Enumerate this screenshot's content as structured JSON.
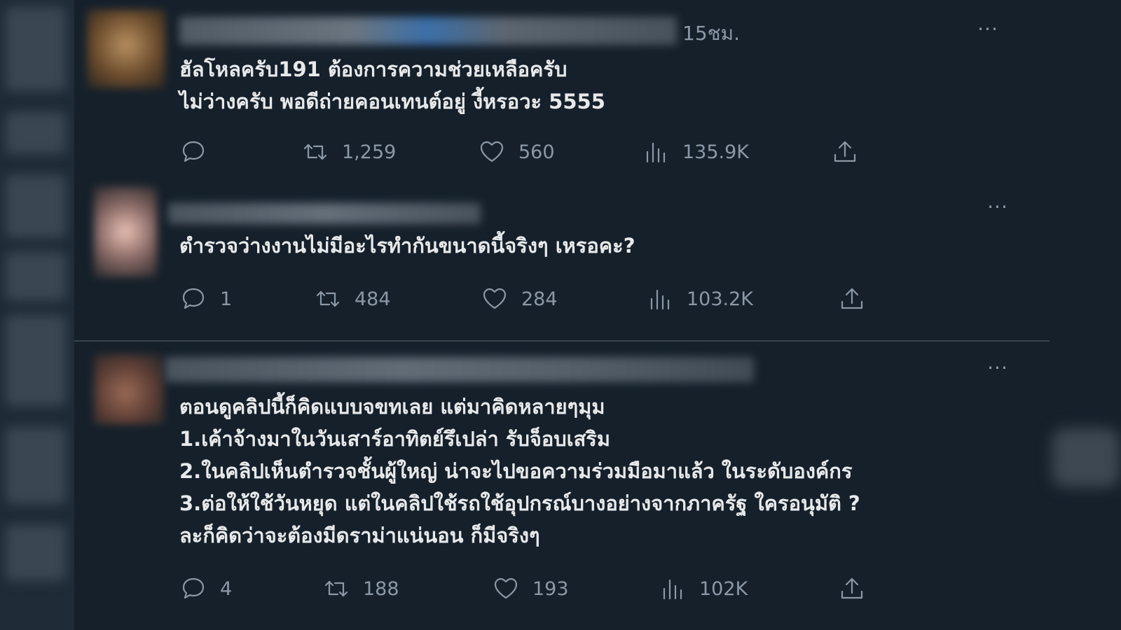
{
  "tweets": [
    {
      "timestamp": "15ชม.",
      "more": "···",
      "lines": [
        "ฮัลโหลครับ191 ต้องการความช่วยเหลือครับ",
        "ไม่ว่างครับ พอดีถ่ายคอนเทนต์อยู่ งี้หรอวะ 5555"
      ],
      "replies": "",
      "retweets": "1,259",
      "likes": "560",
      "views": "135.9K"
    },
    {
      "more": "···",
      "lines": [
        "ตำรวจว่างงานไม่มีอะไรทำกันขนาดนี้จริงๆ เหรอคะ?"
      ],
      "replies": "1",
      "retweets": "484",
      "likes": "284",
      "views": "103.2K"
    },
    {
      "more": "···",
      "lines": [
        "ตอนดูคลิปนี้ก็คิดแบบจขทเลย แต่มาคิดหลายๆมุม",
        "1.เค้าจ้างมาในวันเสาร์อาทิตย์รึเปล่า รับจ็อบเสริม",
        "2.ในคลิปเห็นตำรวจชั้นผู้ใหญ่ น่าจะไปขอความร่วมมือมาแล้ว ในระดับองค์กร",
        "3.ต่อให้ใช้วันหยุด แต่ในคลิปใช้รถใช้อุปกรณ์บางอย่างจากภาครัฐ ใครอนุมัติ ?",
        "ละก็คิดว่าจะต้องมีดราม่าแน่นอน ก็มีจริงๆ"
      ],
      "replies": "4",
      "retweets": "188",
      "likes": "193",
      "views": "102K"
    }
  ],
  "icons": {
    "reply": "reply-icon",
    "retweet": "retweet-icon",
    "like": "like-icon",
    "views": "views-icon",
    "share": "share-icon"
  },
  "colors": {
    "background": "#15202b",
    "text": "#e7e9ea",
    "muted": "#8b98a5",
    "divider": "#38444d"
  }
}
